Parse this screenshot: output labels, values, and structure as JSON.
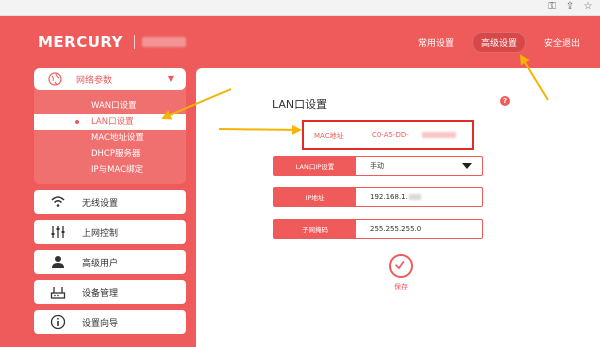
{
  "header": {
    "brand": "MERCURY",
    "nav": [
      {
        "label": "常用设置",
        "active": false
      },
      {
        "label": "高级设置",
        "active": true
      },
      {
        "label": "安全退出",
        "active": false
      }
    ]
  },
  "sidebar": {
    "group": {
      "label": "网络参数",
      "icon": "globe-icon",
      "subitems": [
        {
          "label": "WAN口设置",
          "active": false
        },
        {
          "label": "LAN口设置",
          "active": true
        },
        {
          "label": "MAC地址设置",
          "active": false
        },
        {
          "label": "DHCP服务器",
          "active": false
        },
        {
          "label": "IP与MAC绑定",
          "active": false
        }
      ]
    },
    "menu": [
      {
        "label": "无线设置",
        "icon": "wifi-icon"
      },
      {
        "label": "上网控制",
        "icon": "sliders-icon"
      },
      {
        "label": "高级用户",
        "icon": "user-icon"
      },
      {
        "label": "设备管理",
        "icon": "router-icon"
      },
      {
        "label": "设置向导",
        "icon": "info-icon"
      }
    ]
  },
  "panel": {
    "title": "LAN口设置",
    "help": "?",
    "mac": {
      "label": "MAC地址",
      "value": "C0-A5-DD-"
    },
    "fields": [
      {
        "label": "LAN口IP设置",
        "value": "手动",
        "type": "select"
      },
      {
        "label": "IP地址",
        "value": "192.168.1.",
        "type": "text"
      },
      {
        "label": "子网掩码",
        "value": "255.255.255.0",
        "type": "text"
      }
    ],
    "save_label": "保存"
  },
  "colors": {
    "brand_red": "#ef5b5b",
    "highlight_red": "#e52a2a",
    "arrow_yellow": "#f5b400"
  }
}
